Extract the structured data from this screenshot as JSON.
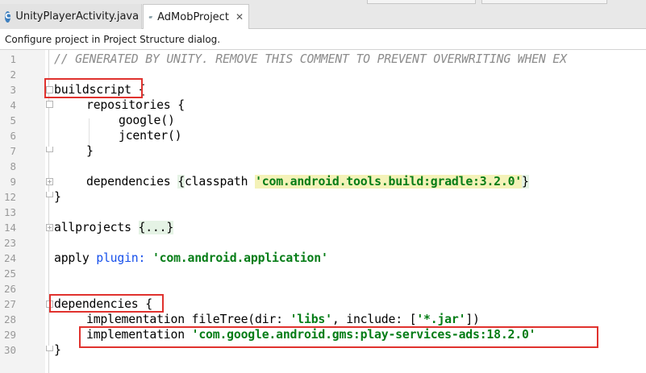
{
  "tabs": [
    {
      "label": "UnityPlayerActivity.java",
      "icon": "c-class-icon"
    },
    {
      "label": "AdMobProject",
      "icon": "gradle-elephant-icon",
      "close": "✕"
    }
  ],
  "notification": "Configure project in Project Structure dialog.",
  "editor": {
    "line_numbers": [
      "1",
      "2",
      "3",
      "4",
      "5",
      "6",
      "7",
      "8",
      "9",
      "12",
      "13",
      "14",
      "23",
      "24",
      "25",
      "26",
      "27",
      "28",
      "29",
      "30"
    ],
    "comment": "// GENERATED BY UNITY. REMOVE THIS COMMENT TO PREVENT OVERWRITING WHEN EX",
    "buildscript": "buildscript",
    "open_brace": "{",
    "close_brace": "}",
    "repositories": "repositories",
    "google": "google()",
    "jcenter": "jcenter()",
    "dependencies": "dependencies",
    "classpath": "classpath",
    "classpath_value": "'com.android.tools.build:gradle:3.2.0'",
    "allprojects": "allprojects",
    "collapsed": "{...}",
    "apply": "apply",
    "plugin": "plugin:",
    "plugin_value": "'com.android.application'",
    "implementation": "implementation",
    "filetree": "fileTree(dir: ",
    "libs": "'libs'",
    "comma_include": ", include: [",
    "jar": "'*.jar'",
    "close_paren": "])",
    "ads_value": "'com.google.android.gms:play-services-ads:18.2.0'"
  },
  "colors": {
    "highlight_box": "#e0322e",
    "string": "#067d17",
    "keyword": "#1750eb",
    "comment": "#8c8c8c"
  }
}
